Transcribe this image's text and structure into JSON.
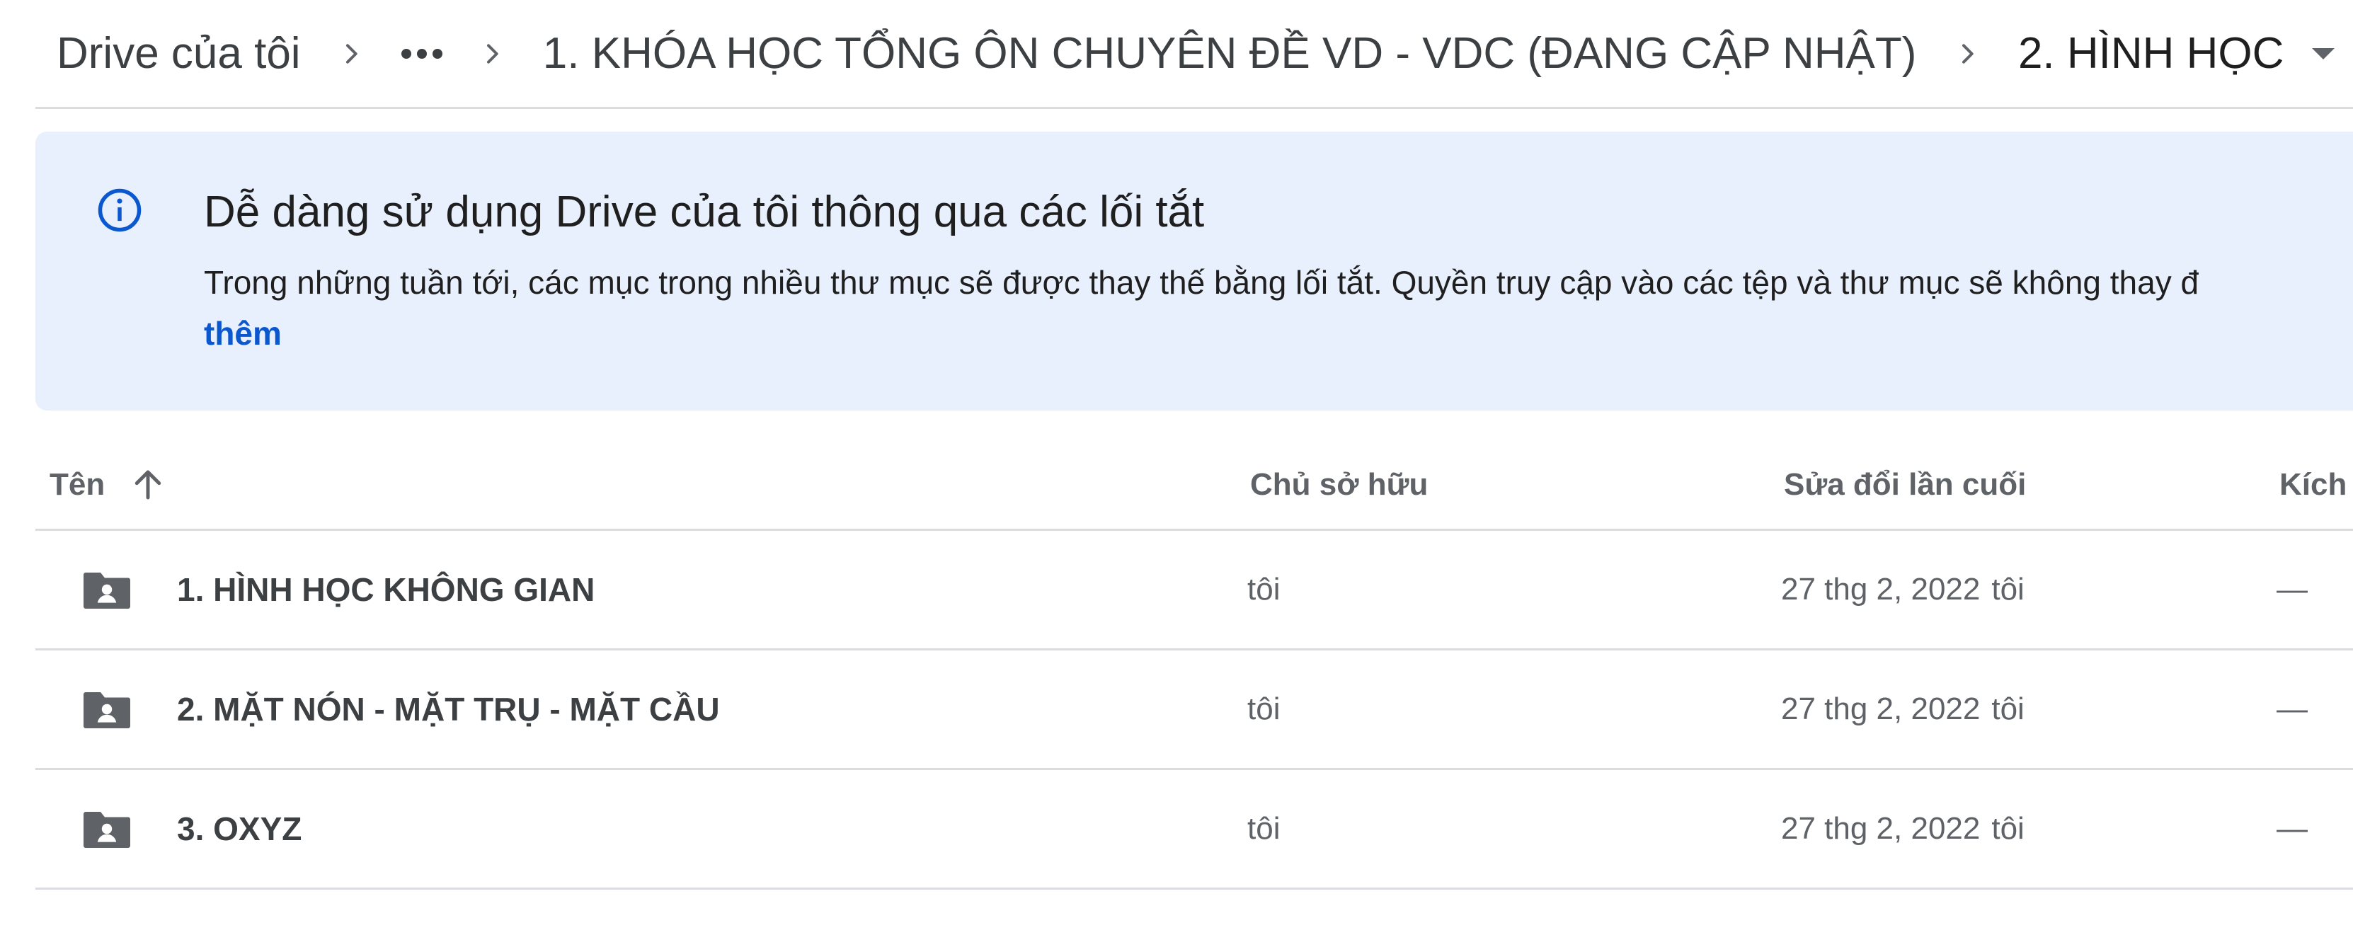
{
  "breadcrumb": {
    "root": "Drive của tôi",
    "more_icon": "more-horiz-icon",
    "parent": "1. KHÓA HỌC TỔNG ÔN CHUYÊN ĐỀ VD - VDC (ĐANG CẬP NHẬT)",
    "current": "2. HÌNH HỌC",
    "separator_icon": "chevron-right-icon",
    "dropdown_icon": "arrow-drop-down-icon"
  },
  "banner": {
    "icon": "info-icon",
    "title": "Dễ dàng sử dụng Drive của tôi thông qua các lối tắt",
    "text": "Trong những tuần tới, các mục trong nhiều thư mục sẽ được thay thế bằng lối tắt. Quyền truy cập vào các tệp và thư mục sẽ không thay đ",
    "link": "thêm",
    "background": "#e8f0fe",
    "accent": "#0b57d0"
  },
  "table": {
    "columns": {
      "name": "Tên",
      "owner": "Chủ sở hữu",
      "modified": "Sửa đổi lần cuối",
      "size": "Kích t"
    },
    "sort_icon": "arrow-upward-icon",
    "rows": [
      {
        "icon": "shared-folder-icon",
        "name": "1. HÌNH HỌC KHÔNG GIAN",
        "owner": "tôi",
        "modified_date": "27 thg 2, 2022",
        "modified_by": "tôi",
        "size": "—"
      },
      {
        "icon": "shared-folder-icon",
        "name": "2. MẶT NÓN - MẶT TRỤ - MẶT CẦU",
        "owner": "tôi",
        "modified_date": "27 thg 2, 2022",
        "modified_by": "tôi",
        "size": "—"
      },
      {
        "icon": "shared-folder-icon",
        "name": "3. OXYZ",
        "owner": "tôi",
        "modified_date": "27 thg 2, 2022",
        "modified_by": "tôi",
        "size": "—"
      }
    ]
  }
}
